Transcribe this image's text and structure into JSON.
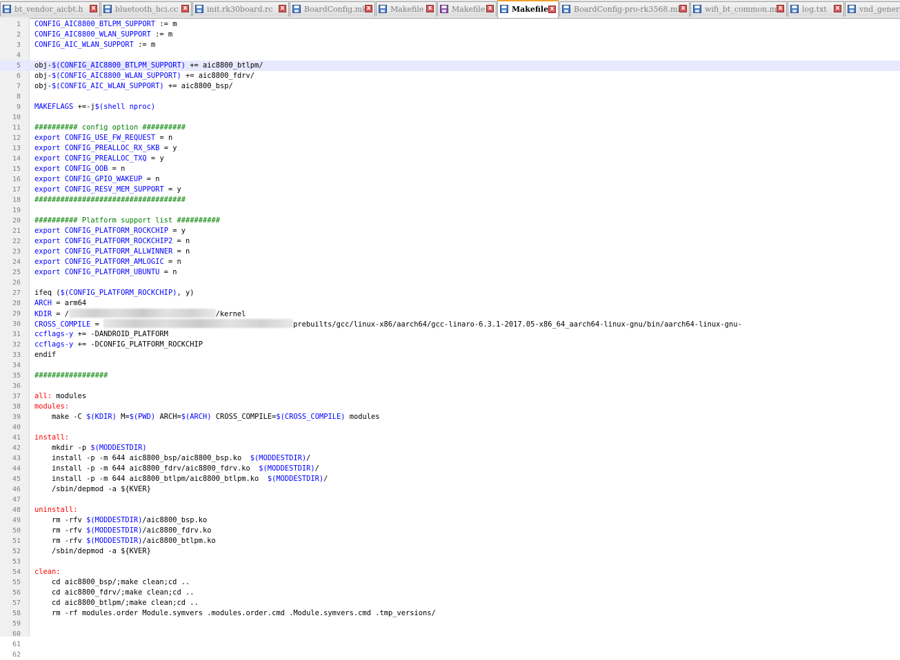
{
  "tabs": [
    {
      "label": "bt_vendor_aicbt.h",
      "icon": "file-save-blue-icon",
      "active": false
    },
    {
      "label": "bluetooth_hci.cc",
      "icon": "file-save-blue-icon",
      "active": false
    },
    {
      "label": "init.rk30board.rc",
      "icon": "file-save-blue-icon",
      "active": false
    },
    {
      "label": "BoardConfig.mk",
      "icon": "file-save-blue-icon",
      "active": false
    },
    {
      "label": "Makefile",
      "icon": "file-save-blue-icon",
      "active": false
    },
    {
      "label": "Makefile",
      "icon": "file-save-purple-icon",
      "active": false
    },
    {
      "label": "Makefile",
      "icon": "file-save-blue-icon",
      "active": true
    },
    {
      "label": "BoardConfig-pro-rk3568.mk",
      "icon": "file-save-blue-icon",
      "active": false
    },
    {
      "label": "wifi_bt_common.mk",
      "icon": "file-save-blue-icon",
      "active": false
    },
    {
      "label": "log.txt",
      "icon": "file-save-blue-icon",
      "active": false
    },
    {
      "label": "vnd_generic",
      "icon": "file-save-blue-icon",
      "active": false
    }
  ],
  "close_glyph": "x",
  "editor": {
    "current_line": 5,
    "lines": [
      [
        [
          "var",
          "CONFIG_AIC8800_BTLPM_SUPPORT"
        ],
        [
          "t",
          " := m"
        ]
      ],
      [
        [
          "var",
          "CONFIG_AIC8800_WLAN_SUPPORT"
        ],
        [
          "t",
          " := m"
        ]
      ],
      [
        [
          "var",
          "CONFIG_AIC_WLAN_SUPPORT"
        ],
        [
          "t",
          " := m"
        ]
      ],
      [],
      [
        [
          "t",
          "obj-"
        ],
        [
          "var",
          "$(CONFIG_AIC8800_BTLPM_SUPPORT)"
        ],
        [
          "t",
          " += aic8800_btlpm/"
        ]
      ],
      [
        [
          "t",
          "obj-"
        ],
        [
          "var",
          "$(CONFIG_AIC8800_WLAN_SUPPORT)"
        ],
        [
          "t",
          " += aic8800_fdrv/"
        ]
      ],
      [
        [
          "t",
          "obj-"
        ],
        [
          "var",
          "$(CONFIG_AIC_WLAN_SUPPORT)"
        ],
        [
          "t",
          " += aic8800_bsp/"
        ]
      ],
      [],
      [
        [
          "var",
          "MAKEFLAGS"
        ],
        [
          "t",
          " +=-j"
        ],
        [
          "var",
          "$(shell nproc)"
        ]
      ],
      [],
      [
        [
          "cm",
          "########## config option ##########"
        ]
      ],
      [
        [
          "kw",
          "export"
        ],
        [
          "t",
          " "
        ],
        [
          "var",
          "CONFIG_USE_FW_REQUEST"
        ],
        [
          "t",
          " = n"
        ]
      ],
      [
        [
          "kw",
          "export"
        ],
        [
          "t",
          " "
        ],
        [
          "var",
          "CONFIG_PREALLOC_RX_SKB"
        ],
        [
          "t",
          " = y"
        ]
      ],
      [
        [
          "kw",
          "export"
        ],
        [
          "t",
          " "
        ],
        [
          "var",
          "CONFIG_PREALLOC_TXQ"
        ],
        [
          "t",
          " = y"
        ]
      ],
      [
        [
          "kw",
          "export"
        ],
        [
          "t",
          " "
        ],
        [
          "var",
          "CONFIG_OOB"
        ],
        [
          "t",
          " = n"
        ]
      ],
      [
        [
          "kw",
          "export"
        ],
        [
          "t",
          " "
        ],
        [
          "var",
          "CONFIG_GPIO_WAKEUP"
        ],
        [
          "t",
          " = n"
        ]
      ],
      [
        [
          "kw",
          "export"
        ],
        [
          "t",
          " "
        ],
        [
          "var",
          "CONFIG_RESV_MEM_SUPPORT"
        ],
        [
          "t",
          " = y"
        ]
      ],
      [
        [
          "cm",
          "###################################"
        ]
      ],
      [],
      [
        [
          "cm",
          "########## Platform support list ##########"
        ]
      ],
      [
        [
          "kw",
          "export"
        ],
        [
          "t",
          " "
        ],
        [
          "var",
          "CONFIG_PLATFORM_ROCKCHIP"
        ],
        [
          "t",
          " = y"
        ]
      ],
      [
        [
          "kw",
          "export"
        ],
        [
          "t",
          " "
        ],
        [
          "var",
          "CONFIG_PLATFORM_ROCKCHIP2"
        ],
        [
          "t",
          " = n"
        ]
      ],
      [
        [
          "kw",
          "export"
        ],
        [
          "t",
          " "
        ],
        [
          "var",
          "CONFIG_PLATFORM_ALLWINNER"
        ],
        [
          "t",
          " = n"
        ]
      ],
      [
        [
          "kw",
          "export"
        ],
        [
          "t",
          " "
        ],
        [
          "var",
          "CONFIG_PLATFORM_AMLOGIC"
        ],
        [
          "t",
          " = n"
        ]
      ],
      [
        [
          "kw",
          "export"
        ],
        [
          "t",
          " "
        ],
        [
          "var",
          "CONFIG_PLATFORM_UBUNTU"
        ],
        [
          "t",
          " = n"
        ]
      ],
      [],
      [
        [
          "t",
          "ifeq ("
        ],
        [
          "var",
          "$(CONFIG_PLATFORM_ROCKCHIP)"
        ],
        [
          "t",
          ", y)"
        ]
      ],
      [
        [
          "var",
          "ARCH"
        ],
        [
          "t",
          " = arm64"
        ]
      ],
      [
        [
          "var",
          "KDIR"
        ],
        [
          "t",
          " = /"
        ],
        [
          "blur",
          "34"
        ],
        [
          "t",
          "/kernel"
        ]
      ],
      [
        [
          "var",
          "CROSS_COMPILE"
        ],
        [
          "t",
          " = "
        ],
        [
          "blur",
          "44"
        ],
        [
          "t",
          "prebuilts/gcc/linux-x86/aarch64/gcc-linaro-6.3.1-2017.05-x86_64_aarch64-linux-gnu/bin/aarch64-linux-gnu-"
        ]
      ],
      [
        [
          "var",
          "ccflags-y"
        ],
        [
          "t",
          " += -DANDROID_PLATFORM"
        ]
      ],
      [
        [
          "var",
          "ccflags-y"
        ],
        [
          "t",
          " += -DCONFIG_PLATFORM_ROCKCHIP"
        ]
      ],
      [
        [
          "t",
          "endif"
        ]
      ],
      [],
      [
        [
          "cm",
          "#################"
        ]
      ],
      [],
      [
        [
          "tgt",
          "all:"
        ],
        [
          "t",
          " modules"
        ]
      ],
      [
        [
          "tgt",
          "modules:"
        ]
      ],
      [
        [
          "t",
          "    make -C "
        ],
        [
          "var",
          "$(KDIR)"
        ],
        [
          "t",
          " M="
        ],
        [
          "var",
          "$(PWD)"
        ],
        [
          "t",
          " ARCH="
        ],
        [
          "var",
          "$(ARCH)"
        ],
        [
          "t",
          " CROSS_COMPILE="
        ],
        [
          "var",
          "$(CROSS_COMPILE)"
        ],
        [
          "t",
          " modules"
        ]
      ],
      [],
      [
        [
          "tgt",
          "install:"
        ]
      ],
      [
        [
          "t",
          "    mkdir -p "
        ],
        [
          "var",
          "$(MODDESTDIR)"
        ]
      ],
      [
        [
          "t",
          "    install -p -m 644 aic8800_bsp/aic8800_bsp.ko  "
        ],
        [
          "var",
          "$(MODDESTDIR)"
        ],
        [
          "t",
          "/"
        ]
      ],
      [
        [
          "t",
          "    install -p -m 644 aic8800_fdrv/aic8800_fdrv.ko  "
        ],
        [
          "var",
          "$(MODDESTDIR)"
        ],
        [
          "t",
          "/"
        ]
      ],
      [
        [
          "t",
          "    install -p -m 644 aic8800_btlpm/aic8800_btlpm.ko  "
        ],
        [
          "var",
          "$(MODDESTDIR)"
        ],
        [
          "t",
          "/"
        ]
      ],
      [
        [
          "t",
          "    /sbin/depmod -a ${KVER}"
        ]
      ],
      [],
      [
        [
          "tgt",
          "uninstall:"
        ]
      ],
      [
        [
          "t",
          "    rm -rfv "
        ],
        [
          "var",
          "$(MODDESTDIR)"
        ],
        [
          "t",
          "/aic8800_bsp.ko"
        ]
      ],
      [
        [
          "t",
          "    rm -rfv "
        ],
        [
          "var",
          "$(MODDESTDIR)"
        ],
        [
          "t",
          "/aic8800_fdrv.ko"
        ]
      ],
      [
        [
          "t",
          "    rm -rfv "
        ],
        [
          "var",
          "$(MODDESTDIR)"
        ],
        [
          "t",
          "/aic8800_btlpm.ko"
        ]
      ],
      [
        [
          "t",
          "    /sbin/depmod -a ${KVER}"
        ]
      ],
      [],
      [
        [
          "tgt",
          "clean:"
        ]
      ],
      [
        [
          "t",
          "    cd aic8800_bsp/;make clean;cd .."
        ]
      ],
      [
        [
          "t",
          "    cd aic8800_fdrv/;make clean;cd .."
        ]
      ],
      [
        [
          "t",
          "    cd aic8800_btlpm/;make clean;cd .."
        ]
      ],
      [
        [
          "t",
          "    rm -rf modules.order Module.symvers .modules.order.cmd .Module.symvers.cmd .tmp_versions/"
        ]
      ],
      [],
      [],
      [],
      []
    ]
  },
  "colors": {
    "keyword": "#0000ff",
    "comment": "#008000",
    "target": "#ff0000",
    "current_line_bg": "#e8e8ff",
    "active_tab_accent": "#f0a030"
  }
}
